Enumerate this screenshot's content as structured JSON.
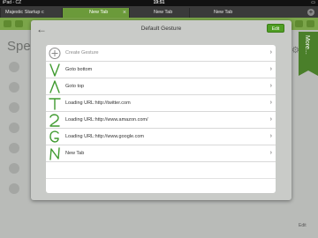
{
  "status_bar": {
    "carrier": "iPad ◦ CZ",
    "time": "19:51",
    "battery": "▭"
  },
  "tabs": [
    {
      "label": "Majestic Startup c",
      "active": false
    },
    {
      "label": "New Tab",
      "active": true
    },
    {
      "label": "New Tab",
      "active": false
    },
    {
      "label": "New Tab",
      "active": false
    }
  ],
  "background_page": {
    "title": "Speed",
    "more_label": "More...",
    "edit_label": "Edit"
  },
  "modal": {
    "title": "Default Gesture",
    "edit_label": "Edit",
    "rows": [
      {
        "glyph": "plus-circle-icon",
        "label": "Create Gesture"
      },
      {
        "glyph": "gesture-v-icon",
        "label": "Goto bottom"
      },
      {
        "glyph": "gesture-caret-icon",
        "label": "Goto top"
      },
      {
        "glyph": "gesture-t-icon",
        "label": "Loading URL:http://twitter.com"
      },
      {
        "glyph": "gesture-2-icon",
        "label": "Loading URL:http://www.amazon.com/"
      },
      {
        "glyph": "gesture-g-icon",
        "label": "Loading URL:http://www.google.com"
      },
      {
        "glyph": "gesture-n-icon",
        "label": "New Tab"
      }
    ]
  },
  "colors": {
    "gesture_green": "#3f9a2f",
    "accent": "#4f9e24",
    "chrome_green": "#7ba54a"
  }
}
